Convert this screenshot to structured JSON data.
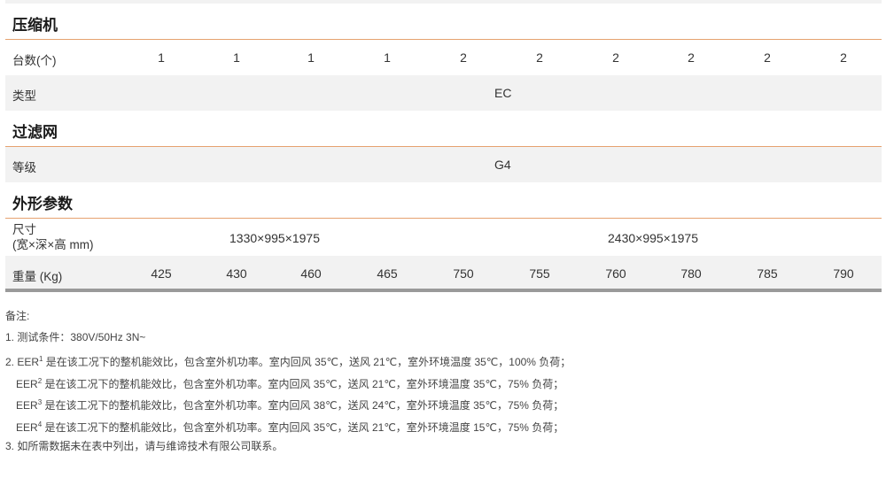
{
  "sections": {
    "compressor": "压缩机",
    "filter": "过滤网",
    "dimensions": "外形参数"
  },
  "rows": {
    "count": {
      "label": "台数(个)",
      "values": [
        "1",
        "1",
        "1",
        "1",
        "2",
        "2",
        "2",
        "2",
        "2",
        "2"
      ]
    },
    "type": {
      "label": "类型",
      "value": "EC"
    },
    "grade": {
      "label": "等级",
      "value": "G4"
    },
    "size": {
      "label_line1": "尺寸",
      "label_line2": "(宽×深×高 mm)",
      "value_small": "1330×995×1975",
      "value_large": "2430×995×1975"
    },
    "weight": {
      "label": "重量 (Kg)",
      "values": [
        "425",
        "430",
        "460",
        "465",
        "750",
        "755",
        "760",
        "780",
        "785",
        "790"
      ]
    }
  },
  "notes": {
    "title": "备注:",
    "n1": "1. 测试条件：380V/50Hz 3N~",
    "eer_prefix_first": "2. EER",
    "eer_prefix": "EER",
    "sup1": "1",
    "sup2": "2",
    "sup3": "3",
    "sup4": "4",
    "eer1_text": " 是在该工况下的整机能效比，包含室外机功率。室内回风 35℃，送风 21℃，室外环境温度 35℃，100% 负荷；",
    "eer2_text": " 是在该工况下的整机能效比，包含室外机功率。室内回风 35℃，送风 21℃，室外环境温度 35℃，75% 负荷；",
    "eer3_text": " 是在该工况下的整机能效比，包含室外机功率。室内回风 38℃，送风 24℃，室外环境温度 35℃，75% 负荷；",
    "eer4_text": " 是在该工况下的整机能效比，包含室外机功率。室内回风 35℃，送风 21℃，室外环境温度 15℃，75% 负荷；",
    "n3": "3. 如所需数据未在表中列出，请与维谛技术有限公司联系。"
  }
}
